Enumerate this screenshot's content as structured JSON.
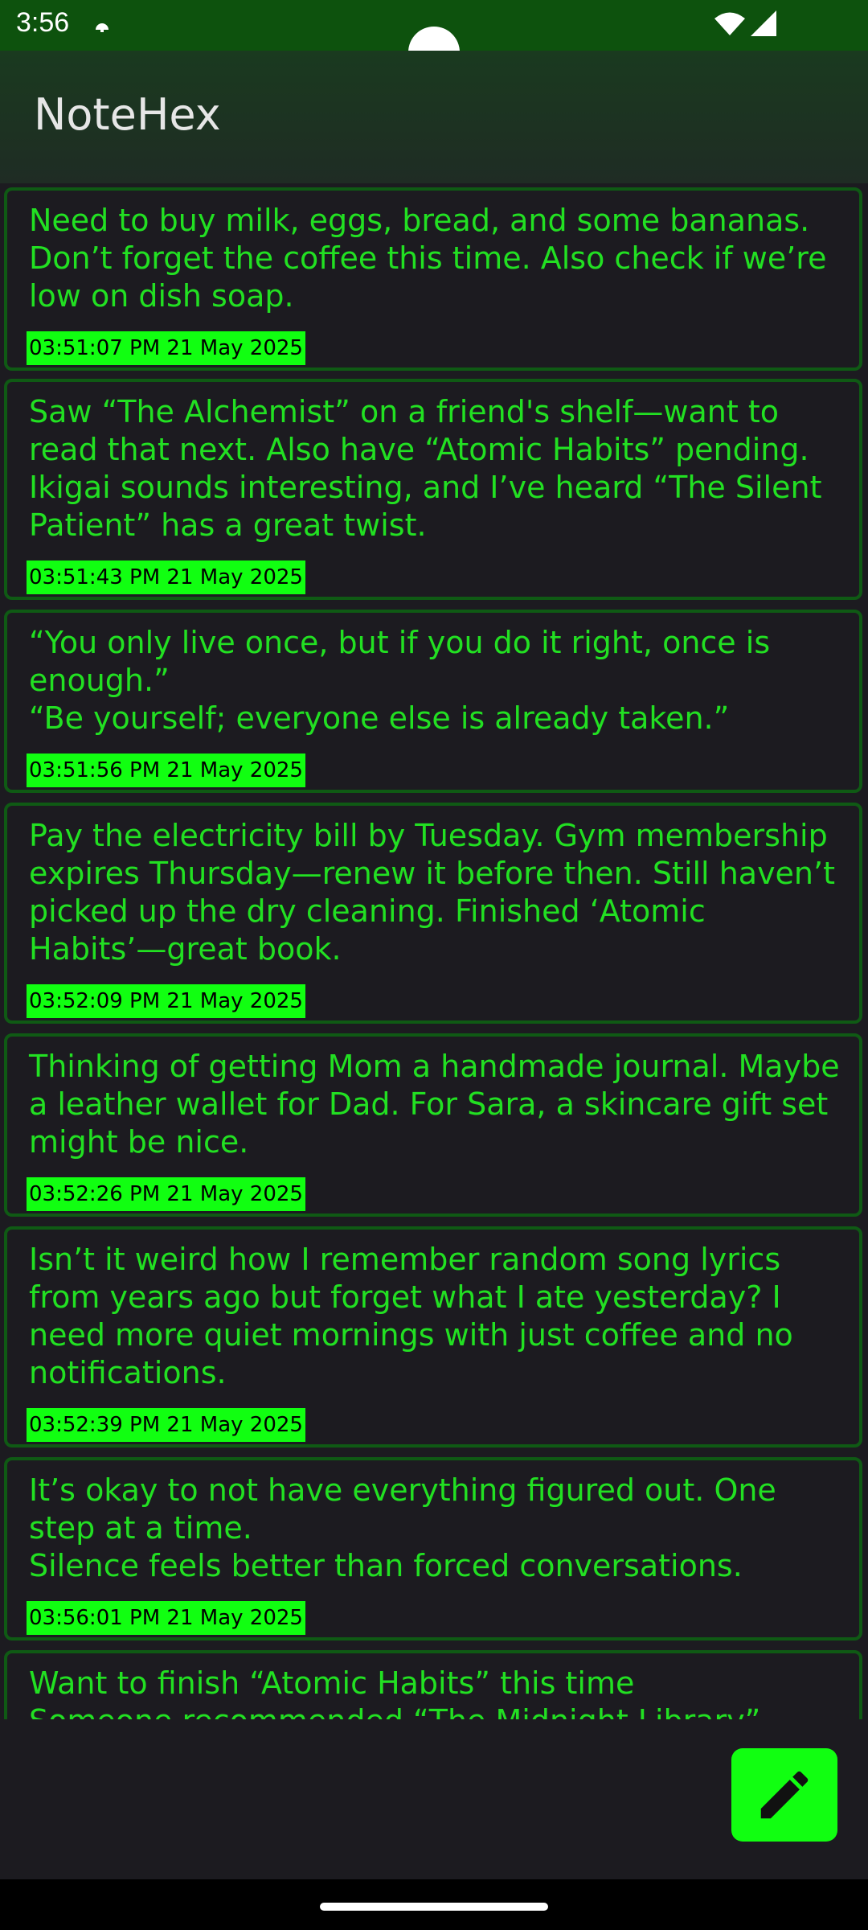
{
  "status_bar": {
    "time": "3:56",
    "icons": [
      "notification-icon",
      "wifi-icon",
      "signal-icon"
    ]
  },
  "app_bar": {
    "title": "NoteHex"
  },
  "notes": [
    {
      "text": "Need to buy milk, eggs, bread, and some bananas.\nDon’t forget the coffee this time. Also check if we’re low on dish soap.",
      "timestamp": "03:51:07 PM 21 May 2025"
    },
    {
      "text": "Saw “The Alchemist” on a friend's shelf—want to read that next. Also have “Atomic Habits” pending. Ikigai sounds interesting, and I’ve heard “The Silent Patient” has a great twist.",
      "timestamp": "03:51:43 PM 21 May 2025"
    },
    {
      "text": "“You only live once, but if you do it right, once is enough.”\n“Be yourself; everyone else is already taken.”",
      "timestamp": "03:51:56 PM 21 May 2025"
    },
    {
      "text": "Pay the electricity bill by Tuesday. Gym membership expires Thursday—renew it before then. Still haven’t picked up the dry cleaning. Finished ‘Atomic Habits’—great book.",
      "timestamp": "03:52:09 PM 21 May 2025"
    },
    {
      "text": "Thinking of getting Mom a handmade journal. Maybe a leather wallet for Dad. For Sara, a skincare gift set might be nice.",
      "timestamp": "03:52:26 PM 21 May 2025"
    },
    {
      "text": "Isn’t it weird how I remember random song lyrics from years ago but forget what I ate yesterday? I need more quiet mornings with just coffee and no notifications.",
      "timestamp": "03:52:39 PM 21 May 2025"
    },
    {
      "text": "It’s okay to not have everything figured out. One step at a time.\nSilence feels better than forced conversations.",
      "timestamp": "03:56:01 PM 21 May 2025"
    },
    {
      "text": "Want to finish “Atomic Habits” this time\nSomeone recommended “The Midnight Library”",
      "timestamp": ""
    }
  ],
  "fab": {
    "icon": "edit-pencil-icon"
  },
  "colors": {
    "accent": "#11ff11",
    "note_text": "#22e022",
    "card_border": "#0f5a14",
    "background": "#1c1b20",
    "status_bar": "#0d520d"
  }
}
